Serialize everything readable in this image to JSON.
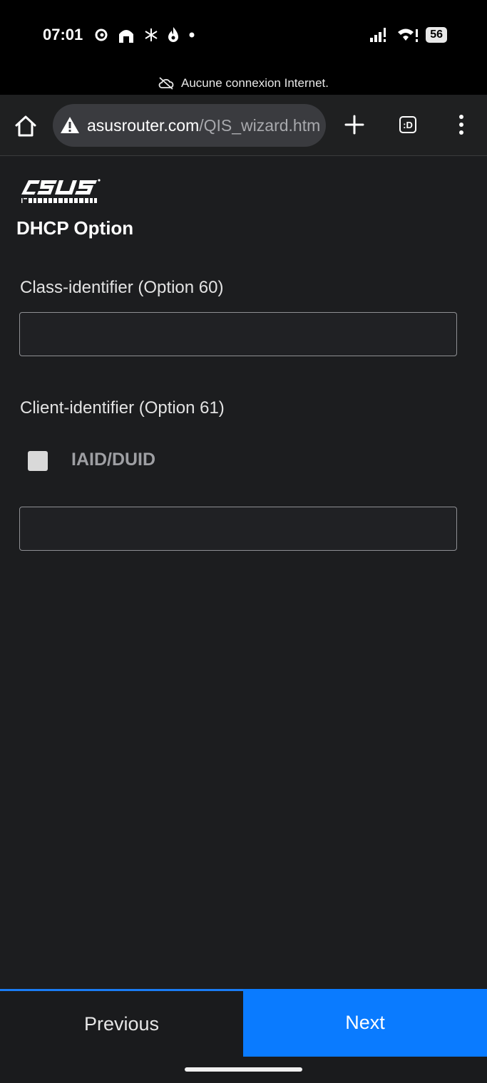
{
  "status_bar": {
    "time": "07:01",
    "battery": "56"
  },
  "offline_banner": {
    "text": "Aucune connexion Internet."
  },
  "browser": {
    "url_host": "asusrouter.com",
    "url_path": "/QIS_wizard.htm",
    "tab_switcher_label": ":D"
  },
  "page": {
    "logo_alt": "ASUS IN SEARCH OF INCREDIBLE",
    "title": "DHCP Option",
    "class_identifier_label": "Class-identifier (Option 60)",
    "class_identifier_value": "",
    "client_identifier_label": "Client-identifier (Option 61)",
    "iaid_duid_label": "IAID/DUID",
    "client_identifier_value": ""
  },
  "footer": {
    "previous_label": "Previous",
    "next_label": "Next"
  },
  "colors": {
    "accent": "#0a7bff",
    "background": "#1c1d1f"
  }
}
